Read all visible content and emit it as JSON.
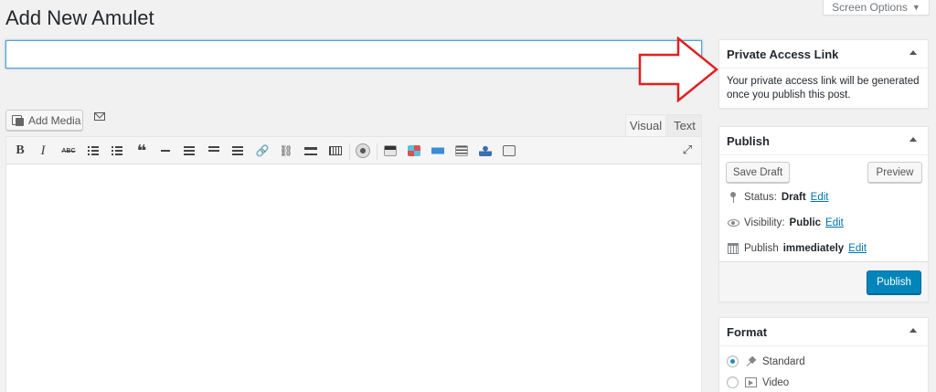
{
  "page": {
    "title": "Add New Amulet"
  },
  "screen_options": {
    "label": "Screen Options",
    "caret": "▼"
  },
  "title_input": {
    "value": "",
    "placeholder": ""
  },
  "media": {
    "add_media_label": "Add Media",
    "email_icon": "envelope-icon"
  },
  "editor": {
    "tabs": [
      {
        "label": "Visual"
      },
      {
        "label": "Text"
      }
    ],
    "toolbar": {
      "bold": "B",
      "italic": "I",
      "strikethrough": "ABC",
      "blockquote": "❝",
      "link": "🔗",
      "unlink": "⛓",
      "fullscreen": "⤢"
    },
    "content": ""
  },
  "private_access": {
    "title": "Private Access Link",
    "body": "Your private access link will be generated once you publish this post."
  },
  "publish": {
    "title": "Publish",
    "save_draft_label": "Save Draft",
    "preview_label": "Preview",
    "status_label": "Status:",
    "status_value": "Draft",
    "status_edit": "Edit",
    "visibility_label": "Visibility:",
    "visibility_value": "Public",
    "visibility_edit": "Edit",
    "publish_label": "Publish",
    "publish_value": "immediately",
    "publish_edit": "Edit",
    "publish_button": "Publish",
    "accent_color": "#0085ba"
  },
  "format": {
    "title": "Format",
    "options": [
      {
        "label": "Standard",
        "selected": true,
        "icon": "pushpin-icon"
      },
      {
        "label": "Video",
        "selected": false,
        "icon": "video-icon"
      }
    ]
  },
  "annotation": {
    "arrow_color": "#e02020"
  }
}
